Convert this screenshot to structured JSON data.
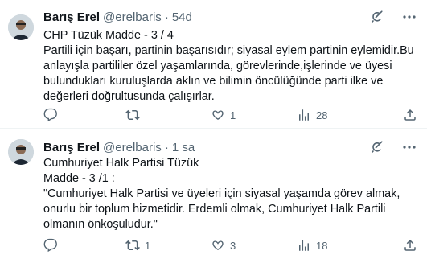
{
  "tweets": [
    {
      "author_name": "Barış Erel",
      "handle": "@erelbaris",
      "separator": "·",
      "time": "54d",
      "text": "CHP Tüzük Madde - 3 / 4\nPartili için başarı, partinin başarısıdır; siyasal eylem partinin eylemidir.Bu anlayışla partililer özel yaşamlarında, görevlerinde,işlerinde ve üyesi bulundukları kuruluşlarda aklın ve bilimin öncülüğünde parti ilke ve değerleri doğrultusunda çalışırlar.",
      "replies": "",
      "retweets": "",
      "likes": "1",
      "views": "28",
      "icons": {
        "avatar": "avatar",
        "grok": "grok-icon",
        "more": "more-icon",
        "reply": "reply-icon",
        "retweet": "retweet-icon",
        "like": "like-icon",
        "views": "views-icon",
        "share": "share-icon"
      }
    },
    {
      "author_name": "Barış Erel",
      "handle": "@erelbaris",
      "separator": "·",
      "time": "1 sa",
      "text": "Cumhuriyet Halk Partisi Tüzük\nMadde - 3 /1 :\n\"Cumhuriyet Halk Partisi ve üyeleri için siyasal yaşamda görev almak, onurlu bir toplum hizmetidir. Erdemli olmak, Cumhuriyet Halk Partili olmanın önkoşuludur.\"",
      "replies": "",
      "retweets": "1",
      "likes": "3",
      "views": "18",
      "icons": {
        "avatar": "avatar",
        "grok": "grok-icon",
        "more": "more-icon",
        "reply": "reply-icon",
        "retweet": "retweet-icon",
        "like": "like-icon",
        "views": "views-icon",
        "share": "share-icon"
      }
    }
  ],
  "colors": {
    "text": "#0f1419",
    "secondary": "#536471",
    "divider": "#eff3f4"
  }
}
